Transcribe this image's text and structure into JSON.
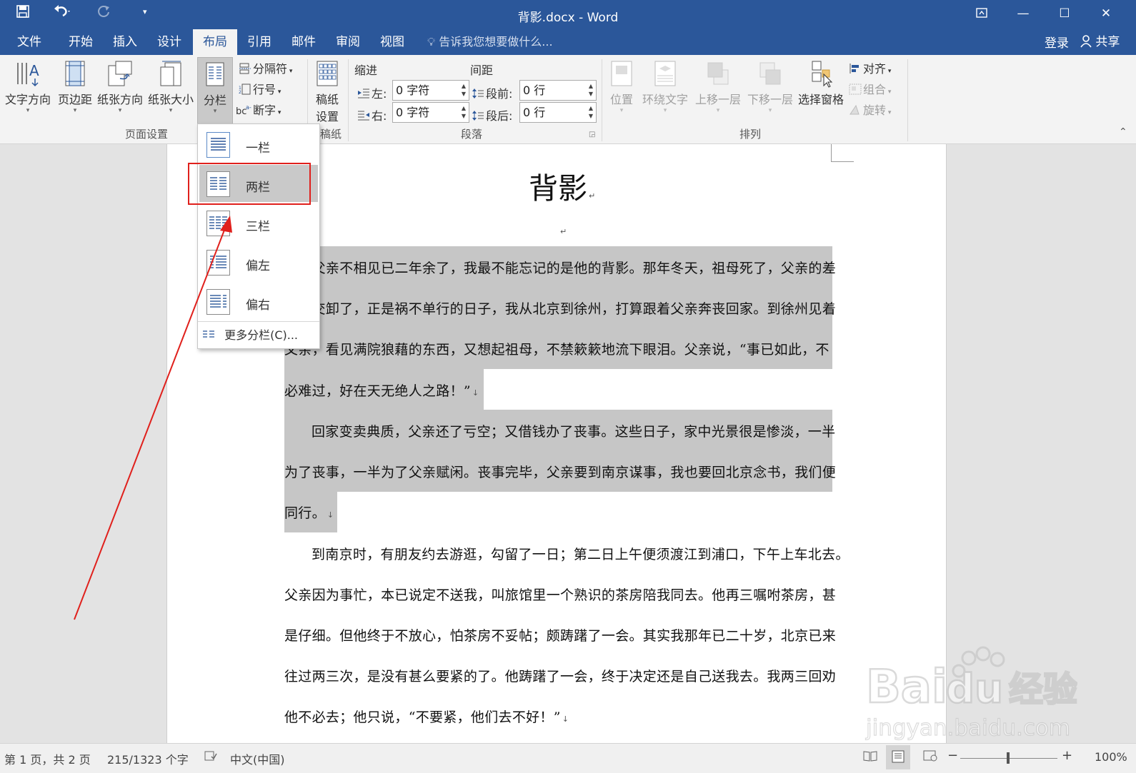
{
  "titlebar": {
    "doc_title": "背影.docx - Word"
  },
  "menu": {
    "tabs": [
      "文件",
      "开始",
      "插入",
      "设计",
      "布局",
      "引用",
      "邮件",
      "审阅",
      "视图"
    ],
    "active_tab": "布局",
    "tell_me": "告诉我您想要做什么...",
    "login": "登录",
    "share": "共享"
  },
  "ribbon": {
    "page_setup": {
      "label": "页面设置",
      "text_direction": "文字方向",
      "margins": "页边距",
      "orientation": "纸张方向",
      "size": "纸张大小",
      "columns": "分栏",
      "breaks": "分隔符",
      "line_numbers": "行号",
      "hyphenation": "断字"
    },
    "draft": {
      "label": "稿纸",
      "button": [
        "稿纸",
        "设置"
      ]
    },
    "paragraph": {
      "label": "段落",
      "indent_title": "缩进",
      "spacing_title": "间距",
      "left_label": "左:",
      "left_value": "0 字符",
      "right_label": "右:",
      "right_value": "0 字符",
      "before_label": "段前:",
      "before_value": "0 行",
      "after_label": "段后:",
      "after_value": "0 行"
    },
    "arrange": {
      "label": "排列",
      "position": "位置",
      "wrap": "环绕文字",
      "forward": "上移一层",
      "backward": "下移一层",
      "selection_pane": "选择窗格",
      "align": "对齐",
      "group": "组合",
      "rotate": "旋转"
    }
  },
  "columns_menu": {
    "items": [
      "一栏",
      "两栏",
      "三栏",
      "偏左",
      "偏右"
    ],
    "highlighted": "两栏",
    "more": "更多分栏(C)..."
  },
  "document": {
    "title": "背影",
    "lines": [
      "我与父亲不相见已二年余了，我最不能忘记的是他的背影。那年冬天，祖母死了，父亲的差",
      "使也交卸了，正是祸不单行的日子，我从北京到徐州，打算跟着父亲奔丧回家。到徐州见着",
      "父亲，看见满院狼藉的东西，又想起祖母，不禁簌簌地流下眼泪。父亲说，“事已如此，不",
      "必难过，好在天无绝人之路！”",
      "回家变卖典质，父亲还了亏空；又借钱办了丧事。这些日子，家中光景很是惨淡，一半",
      "为了丧事，一半为了父亲赋闲。丧事完毕，父亲要到南京谋事，我也要回北京念书，我们便",
      "同行。",
      "到南京时，有朋友约去游逛，勾留了一日；第二日上午便须渡江到浦口，下午上车北去。",
      "父亲因为事忙，本已说定不送我，叫旅馆里一个熟识的茶房陪我同去。他再三嘱咐茶房，甚",
      "是仔细。但他终于不放心，怕茶房不妥帖；颇踌躇了一会。其实我那年已二十岁，北京已来",
      "往过两三次，是没有甚么要紧的了。他踌躇了一会，终于决定还是自己送我去。我两三回劝",
      "他不必去；他只说，“不要紧，他们去不好！”"
    ]
  },
  "statusbar": {
    "page": "第 1 页，共 2 页",
    "words": "215/1323 个字",
    "language": "中文(中国)",
    "zoom": "100%"
  },
  "watermark": {
    "brand": "Baidu经验",
    "url": "jingyan.baidu.com"
  }
}
